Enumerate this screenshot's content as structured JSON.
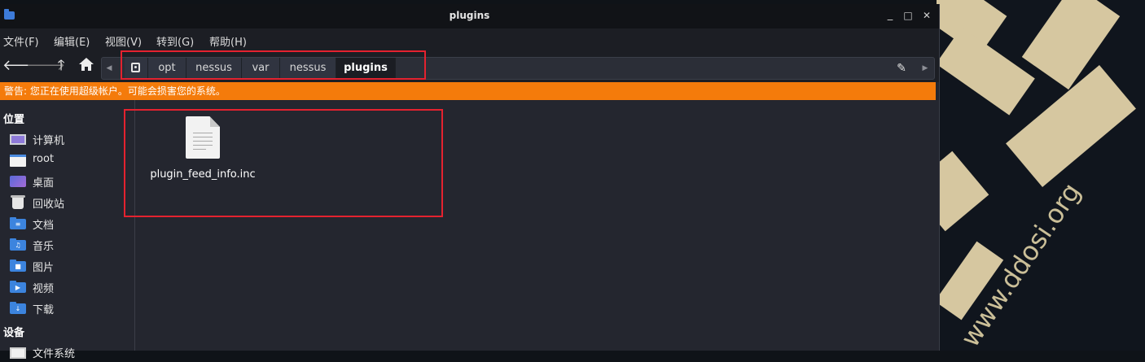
{
  "window": {
    "title": "plugins"
  },
  "window_controls": {
    "minimize": "_",
    "maximize": "□",
    "close": "✕"
  },
  "menu": [
    "文件(F)",
    "编辑(E)",
    "视图(V)",
    "转到(G)",
    "帮助(H)"
  ],
  "toolbar": {
    "back_icon": "arrow-left-icon",
    "forward_icon": "arrow-right-icon",
    "up_icon": "arrow-up-icon",
    "home_icon": "home-icon",
    "edit_icon": "pencil-icon"
  },
  "breadcrumbs": [
    "opt",
    "nessus",
    "var",
    "nessus",
    "plugins"
  ],
  "active_breadcrumb": "plugins",
  "warning": "警告: 您正在使用超级帐户。可能会损害您的系统。",
  "sidebar": {
    "places_heading": "位置",
    "places": [
      {
        "label": "计算机",
        "icon": "computer-icon"
      },
      {
        "label": "root",
        "icon": "home-folder-icon"
      },
      {
        "label": "桌面",
        "icon": "desktop-icon"
      },
      {
        "label": "回收站",
        "icon": "trash-icon"
      },
      {
        "label": "文档",
        "icon": "documents-folder-icon"
      },
      {
        "label": "音乐",
        "icon": "music-folder-icon"
      },
      {
        "label": "图片",
        "icon": "pictures-folder-icon"
      },
      {
        "label": "视频",
        "icon": "videos-folder-icon"
      },
      {
        "label": "下载",
        "icon": "downloads-folder-icon"
      }
    ],
    "devices_heading": "设备",
    "devices": [
      {
        "label": "文件系统",
        "icon": "drive-icon"
      }
    ]
  },
  "files": [
    {
      "name": "plugin_feed_info.inc",
      "icon": "text-file-icon"
    }
  ],
  "wallpaper": {
    "watermark": "www.ddosi.org"
  },
  "colors": {
    "warning": "#f47b0b",
    "highlight": "#e4222f",
    "folder": "#3c84de"
  }
}
